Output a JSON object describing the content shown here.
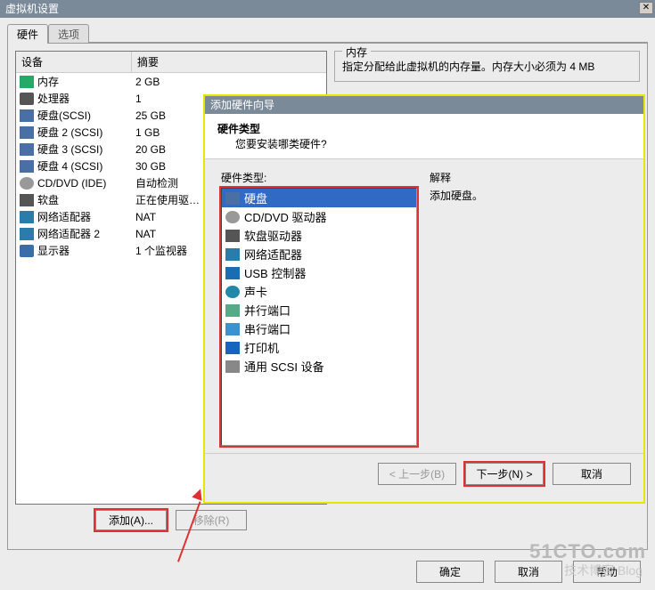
{
  "outer": {
    "title": "虚拟机设置",
    "tab_hw": "硬件",
    "tab_opt": "选项",
    "col_device": "设备",
    "col_summary": "摘要",
    "btn_add": "添加(A)...",
    "btn_remove": "移除(R)",
    "btn_ok": "确定",
    "btn_cancel": "取消",
    "btn_help": "帮助"
  },
  "hw": [
    {
      "name": "内存",
      "val": "2 GB",
      "icon": "ic-mem"
    },
    {
      "name": "处理器",
      "val": "1",
      "icon": "ic-cpu"
    },
    {
      "name": "硬盘(SCSI)",
      "val": "25 GB",
      "icon": "ic-hd"
    },
    {
      "name": "硬盘 2 (SCSI)",
      "val": "1 GB",
      "icon": "ic-hd"
    },
    {
      "name": "硬盘 3 (SCSI)",
      "val": "20 GB",
      "icon": "ic-hd"
    },
    {
      "name": "硬盘 4 (SCSI)",
      "val": "30 GB",
      "icon": "ic-hd"
    },
    {
      "name": "CD/DVD (IDE)",
      "val": "自动检测",
      "icon": "ic-cd"
    },
    {
      "name": "软盘",
      "val": "正在使用驱…",
      "icon": "ic-fd"
    },
    {
      "name": "网络适配器",
      "val": "NAT",
      "icon": "ic-net"
    },
    {
      "name": "网络适配器 2",
      "val": "NAT",
      "icon": "ic-net"
    },
    {
      "name": "显示器",
      "val": "1 个监视器",
      "icon": "ic-mon"
    }
  ],
  "memgroup": {
    "title": "内存",
    "text": "指定分配给此虚拟机的内存量。内存大小必须为 4 MB"
  },
  "wizard": {
    "title": "添加硬件向导",
    "head_bold": "硬件类型",
    "head_sub": "您要安装哪类硬件?",
    "left_label": "硬件类型:",
    "right_label": "解释",
    "right_text": "添加硬盘。",
    "btn_back": "< 上一步(B)",
    "btn_next": "下一步(N) >",
    "btn_cancel": "取消",
    "types": [
      {
        "label": "硬盘",
        "icon": "ic-hd",
        "sel": true
      },
      {
        "label": "CD/DVD 驱动器",
        "icon": "ic-cd"
      },
      {
        "label": "软盘驱动器",
        "icon": "ic-fd"
      },
      {
        "label": "网络适配器",
        "icon": "ic-net"
      },
      {
        "label": "USB 控制器",
        "icon": "ic-usb"
      },
      {
        "label": "声卡",
        "icon": "ic-snd"
      },
      {
        "label": "并行端口",
        "icon": "ic-par"
      },
      {
        "label": "串行端口",
        "icon": "ic-ser"
      },
      {
        "label": "打印机",
        "icon": "ic-prn"
      },
      {
        "label": "通用 SCSI 设备",
        "icon": "ic-gen"
      }
    ]
  },
  "watermark": "51CTO.com",
  "watermark2": "技术博客  Blog"
}
